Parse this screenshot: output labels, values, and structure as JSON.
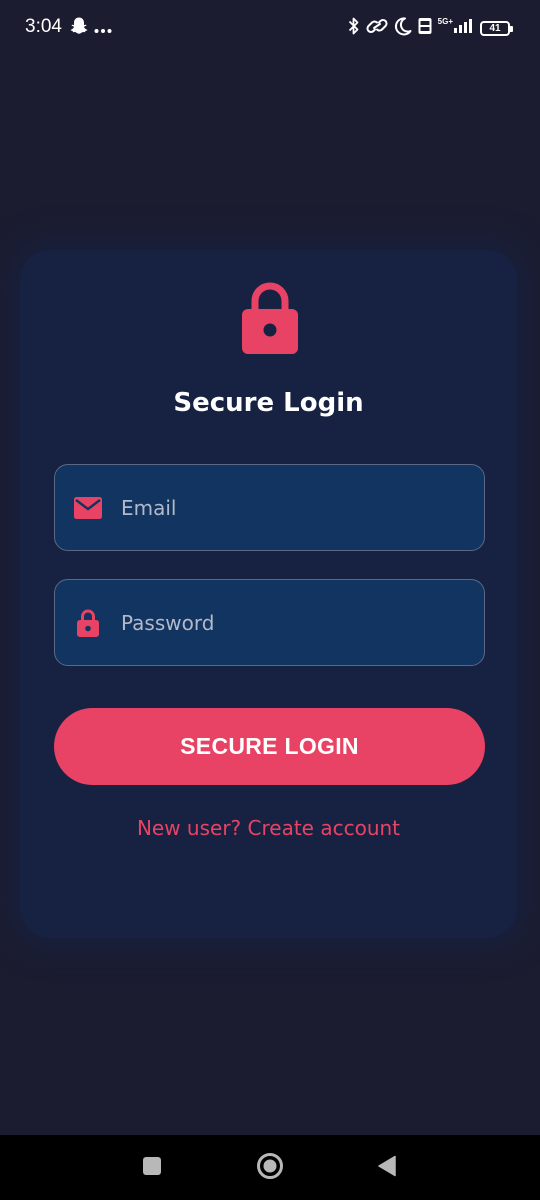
{
  "status_bar": {
    "time": "3:04",
    "battery_level": "41",
    "network_type": "5G+",
    "left_icons": [
      "snapchat-icon",
      "more-dots-icon"
    ],
    "right_icons": [
      "bluetooth-icon",
      "link-icon",
      "moon-icon",
      "volte-icon",
      "signal-icon",
      "battery-icon"
    ]
  },
  "login_card": {
    "icon": "lock-icon",
    "title": "Secure Login",
    "email": {
      "icon": "email-icon",
      "placeholder": "Email",
      "value": ""
    },
    "password": {
      "icon": "lock-icon",
      "placeholder": "Password",
      "value": ""
    },
    "login_button_label": "SECURE LOGIN",
    "create_account_link": "New user? Create account"
  },
  "nav_bar": {
    "buttons": [
      "recents-button",
      "home-button",
      "back-button"
    ]
  },
  "colors": {
    "background": "#1b1c30",
    "card": "#172243",
    "input_background": "#113460",
    "accent": "#e84364",
    "text": "#ffffff"
  }
}
